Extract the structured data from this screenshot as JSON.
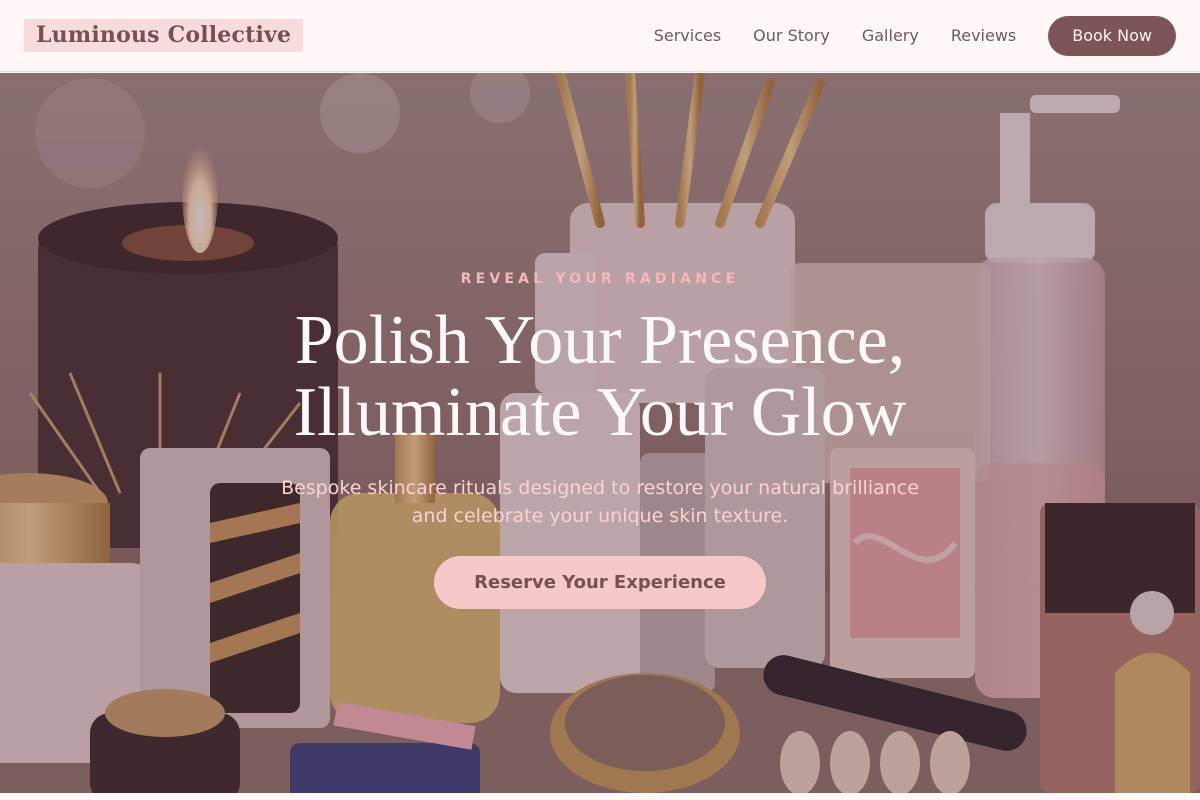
{
  "brand": {
    "name": "Luminous Collective"
  },
  "nav": {
    "links": [
      "Services",
      "Our Story",
      "Gallery",
      "Reviews"
    ],
    "cta": "Book Now"
  },
  "hero": {
    "eyebrow": "REVEAL YOUR RADIANCE",
    "headline_line1": "Polish Your Presence,",
    "headline_line2": "Illuminate Your Glow",
    "subtitle_line1": "Bespoke skincare rituals designed to restore your natural brilliance",
    "subtitle_line2": "and celebrate your unique skin texture.",
    "cta": "Reserve Your Experience"
  },
  "colors": {
    "brand_bg": "#f6dcdc",
    "brand_text": "#7a4f52",
    "book_button": "#7d5558",
    "cta_button": "#f4c9c8",
    "eyebrow": "#f4b9b9"
  },
  "background_image": "cosmetics-vanity-photo"
}
